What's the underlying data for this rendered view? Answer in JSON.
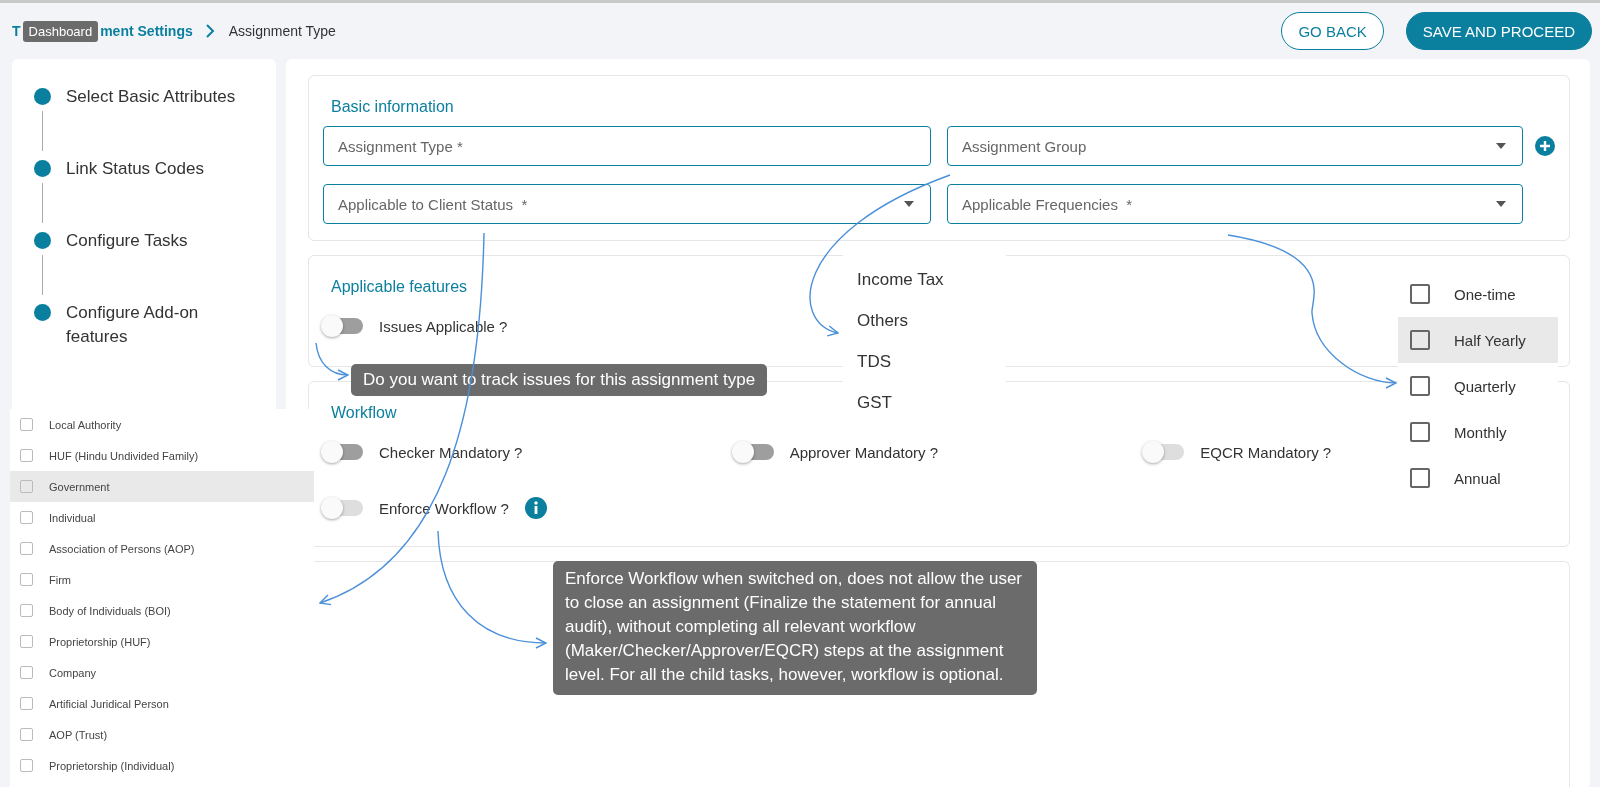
{
  "breadcrumb": {
    "link_start": "T",
    "tooltip": "Dashboard",
    "link_end": "ment Settings",
    "current": "Assignment Type"
  },
  "buttons": [
    {
      "label": "GO BACK",
      "kind": "outline"
    },
    {
      "label": "SAVE AND PROCEED",
      "kind": "primary"
    }
  ],
  "steps": [
    {
      "label": "Select Basic Attributes"
    },
    {
      "label": "Link Status Codes"
    },
    {
      "label": "Configure Tasks"
    },
    {
      "label": "Configure Add-on features"
    }
  ],
  "basic_information": {
    "title": "Basic information",
    "fields": [
      {
        "placeholder": "Assignment Type *",
        "kind": "text"
      },
      {
        "placeholder": "Assignment Group",
        "kind": "select",
        "add": true
      },
      {
        "placeholder": "Applicable to Client Status  *",
        "kind": "select"
      },
      {
        "placeholder": "Applicable Frequencies  *",
        "kind": "select"
      }
    ]
  },
  "applicable_features": {
    "title": "Applicable features",
    "toggles": [
      {
        "label": "Issues Applicable ?",
        "on": false,
        "disabled": false
      }
    ]
  },
  "workflow": {
    "title": "Workflow",
    "toggles": [
      {
        "label": "Checker Mandatory ?",
        "on": false,
        "disabled": false
      },
      {
        "label": "Approver Mandatory ?",
        "on": false,
        "disabled": false
      },
      {
        "label": "EQCR Mandatory ?",
        "on": false,
        "disabled": true
      },
      {
        "label": "Enforce Workflow ?",
        "on": false,
        "disabled": true,
        "info": true
      }
    ]
  },
  "issues_tooltip": "Do you want to track issues for this assignment type",
  "workflow_tooltip": "Enforce Workflow when switched on, does not allow the user to close an assignment (Finalize the statement for annual audit), without completing all relevant workflow (Maker/Checker/Approver/EQCR) steps at the assignment level. For all the child tasks, however, workflow is optional.",
  "group_options": [
    "Income Tax",
    "Others",
    "TDS",
    "GST"
  ],
  "frequency_options": [
    {
      "label": "One-time",
      "checked": false,
      "selected": false
    },
    {
      "label": "Half Yearly",
      "checked": false,
      "selected": true
    },
    {
      "label": "Quarterly",
      "checked": false,
      "selected": false
    },
    {
      "label": "Monthly",
      "checked": false,
      "selected": false
    },
    {
      "label": "Annual",
      "checked": false,
      "selected": false
    }
  ],
  "client_status_options": [
    {
      "label": "Local Authority",
      "checked": false,
      "selected": false
    },
    {
      "label": "HUF (Hindu Undivided Family)",
      "checked": false,
      "selected": false
    },
    {
      "label": "Government",
      "checked": false,
      "selected": true
    },
    {
      "label": "Individual",
      "checked": false,
      "selected": false
    },
    {
      "label": "Association of Persons (AOP)",
      "checked": false,
      "selected": false
    },
    {
      "label": "Firm",
      "checked": false,
      "selected": false
    },
    {
      "label": "Body of Individuals (BOI)",
      "checked": false,
      "selected": false
    },
    {
      "label": "Proprietorship (HUF)",
      "checked": false,
      "selected": false
    },
    {
      "label": "Company",
      "checked": false,
      "selected": false
    },
    {
      "label": "Artificial Juridical Person",
      "checked": false,
      "selected": false
    },
    {
      "label": "AOP (Trust)",
      "checked": false,
      "selected": false
    },
    {
      "label": "Proprietorship (Individual)",
      "checked": false,
      "selected": false
    }
  ]
}
